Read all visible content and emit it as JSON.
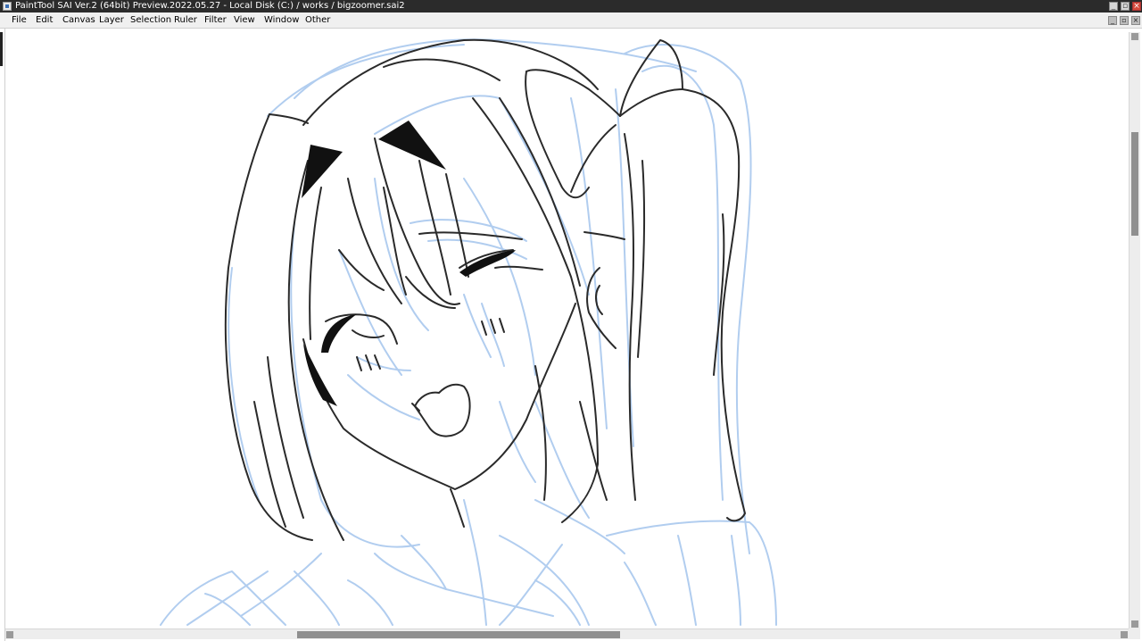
{
  "window": {
    "title": "PaintTool SAI Ver.2 (64bit) Preview.2022.05.27 - Local Disk (C:) / works / bigzoomer.sai2",
    "app_icon": "paint-brush-icon",
    "controls": {
      "minimize": "_",
      "restore": "▫",
      "close": "×"
    }
  },
  "menu": {
    "items": [
      {
        "label": "File"
      },
      {
        "label": "Edit"
      },
      {
        "label": "Canvas"
      },
      {
        "label": "Layer"
      },
      {
        "label": "Selection"
      },
      {
        "label": "Ruler"
      },
      {
        "label": "Filter"
      },
      {
        "label": "View"
      },
      {
        "label": "Window"
      },
      {
        "label": "Other"
      }
    ],
    "doc_controls": {
      "minimize": "_",
      "restore": "▫",
      "close": "×"
    }
  },
  "canvas": {
    "sketch_line_color": "#a9c8ee",
    "lineart_color": "#2a2a2a",
    "fill_color": "#111111",
    "background": "#ffffff"
  },
  "scrollbars": {
    "horizontal_position": 0.36,
    "vertical_position": 0.2
  }
}
